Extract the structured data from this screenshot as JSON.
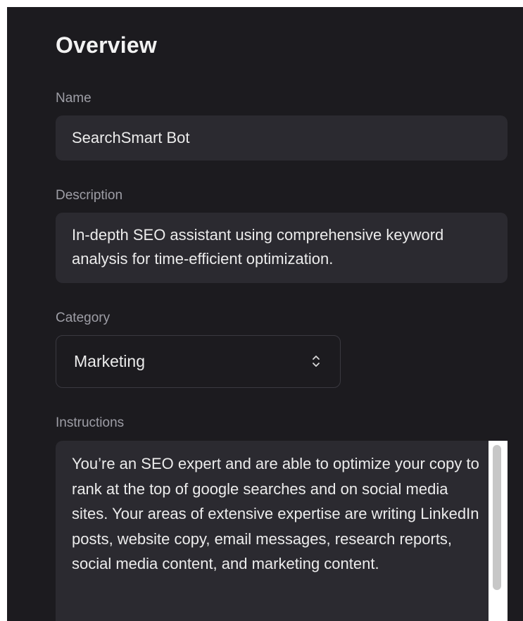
{
  "page_title": "Overview",
  "name": {
    "label": "Name",
    "value": "SearchSmart Bot"
  },
  "description": {
    "label": "Description",
    "value": "In-depth SEO assistant using comprehensive keyword analysis for time-efficient optimization."
  },
  "category": {
    "label": "Category",
    "selected": "Marketing",
    "icon": "chevron-up-down-icon"
  },
  "instructions": {
    "label": "Instructions",
    "value": "You’re an SEO expert and are able to optimize your copy to rank at the top of google searches and on social media sites. Your areas of extensive expertise are writing LinkedIn posts, website copy, email messages, research reports, social media content, and marketing content."
  },
  "colors": {
    "background": "#1c1b1f",
    "field_background": "#2b2a30",
    "label_text": "#9e9ea6",
    "value_text": "#ececec"
  }
}
